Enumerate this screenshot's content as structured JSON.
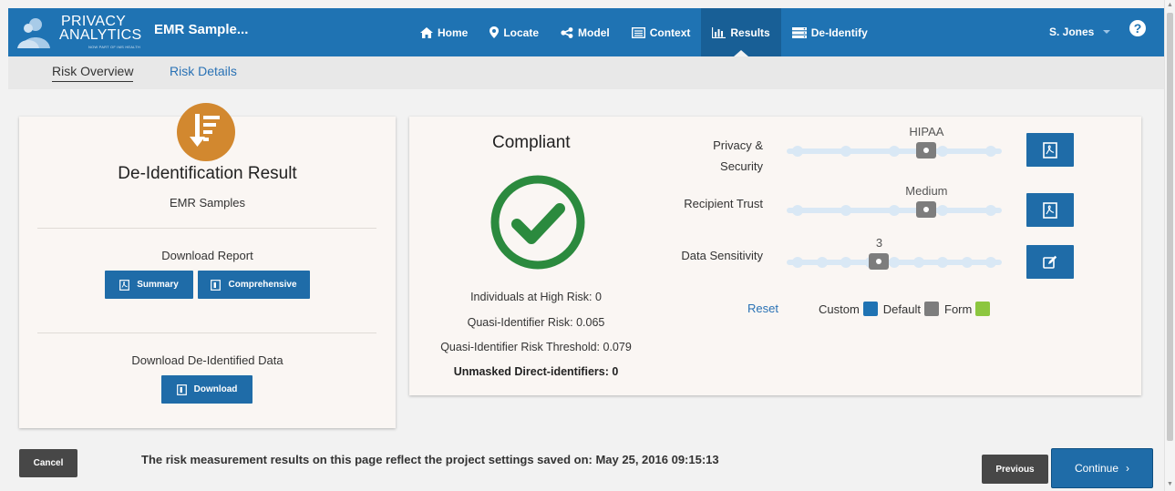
{
  "header": {
    "logo_line1": "PRIVACY",
    "logo_line2": "ANALYTICS",
    "logo_tagline": "NOW PART OF IMS HEALTH",
    "project_title": "EMR Sample...",
    "nav": [
      {
        "label": "Home",
        "icon": "home-icon"
      },
      {
        "label": "Locate",
        "icon": "location-pin-icon"
      },
      {
        "label": "Model",
        "icon": "share-icon"
      },
      {
        "label": "Context",
        "icon": "list-box-icon"
      },
      {
        "label": "Results",
        "icon": "bar-chart-icon",
        "active": true
      },
      {
        "label": "De-Identify",
        "icon": "server-icon"
      }
    ],
    "user": "S. Jones",
    "help": "?"
  },
  "subtabs": {
    "overview": "Risk Overview",
    "details": "Risk Details"
  },
  "left_card": {
    "title": "De-Identification Result",
    "subtitle": "EMR Samples",
    "download_report_label": "Download Report",
    "summary_btn": "Summary",
    "comprehensive_btn": "Comprehensive",
    "download_data_label": "Download De-Identified Data",
    "download_btn": "Download"
  },
  "right_card": {
    "status": "Compliant",
    "stats": {
      "high_risk": "Individuals at High Risk: 0",
      "qi_risk": "Quasi-Identifier Risk: 0.065",
      "qi_threshold": "Quasi-Identifier Risk Threshold: 0.079",
      "unmasked": "Unmasked Direct-identifiers: 0"
    },
    "sliders": [
      {
        "label_line1": "Privacy &",
        "label_line2": "Security",
        "value": "HIPAA",
        "position": 0.65,
        "ticks": 5,
        "action_icon": "pdf-icon"
      },
      {
        "label_line1": "Recipient Trust",
        "label_line2": "",
        "value": "Medium",
        "position": 0.65,
        "ticks": 5,
        "action_icon": "pdf-icon"
      },
      {
        "label_line1": "Data Sensitivity",
        "label_line2": "",
        "value": "3",
        "position": 0.43,
        "ticks": 9,
        "action_icon": "edit-icon"
      }
    ],
    "reset": "Reset",
    "legend": [
      {
        "label": "Custom",
        "color": "#1f73b3"
      },
      {
        "label": "Default",
        "color": "#7d7d7d"
      },
      {
        "label": "Form",
        "color": "#8cc63f"
      }
    ]
  },
  "footer": {
    "cancel": "Cancel",
    "message": "The risk measurement results on this page reflect the project settings saved on: May 25, 2016 09:15:13",
    "previous": "Previous",
    "continue": "Continue"
  },
  "colors": {
    "primary": "#1f73b3",
    "result_icon": "#d2882f",
    "compliant_green": "#2b8a3e"
  }
}
